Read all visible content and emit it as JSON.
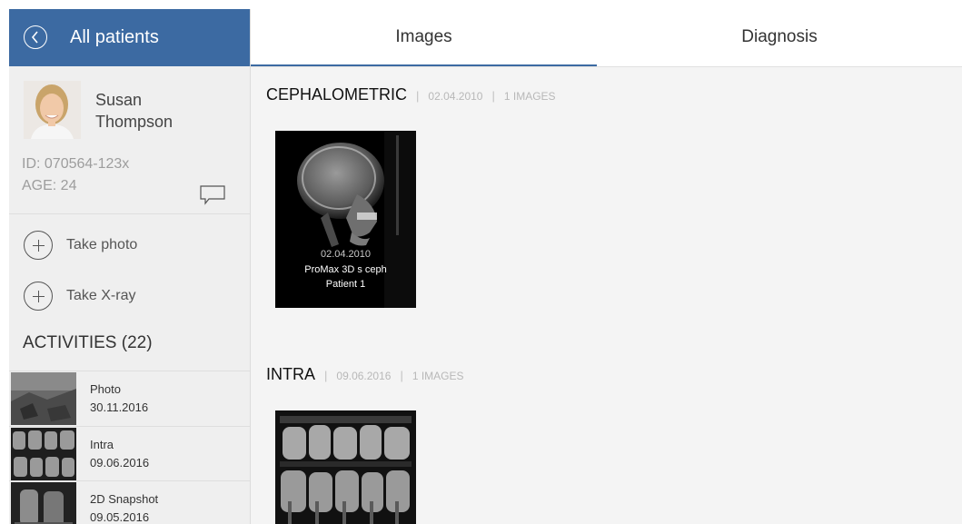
{
  "header": {
    "back_label": "All patients"
  },
  "patient": {
    "first_name": "Susan",
    "last_name": "Thompson",
    "id_text": "ID: 070564-123x",
    "age_text": "AGE: 24"
  },
  "actions": [
    {
      "label": "Take photo"
    },
    {
      "label": "Take X-ray"
    }
  ],
  "activities": {
    "title": "ACTIVITIES (22)",
    "items": [
      {
        "type": "Photo",
        "date": "30.11.2016"
      },
      {
        "type": "Intra",
        "date": "09.06.2016"
      },
      {
        "type": "2D Snapshot",
        "date": "09.05.2016"
      }
    ],
    "more": "..."
  },
  "tabs": [
    {
      "label": "Images",
      "active": true
    },
    {
      "label": "Diagnosis",
      "active": false
    }
  ],
  "sections": [
    {
      "title": "CEPHALOMETRIC",
      "date": "02.04.2010",
      "count": "1 IMAGES",
      "images": [
        {
          "date": "02.04.2010",
          "device": "ProMax 3D s ceph",
          "patient": "Patient 1"
        }
      ]
    },
    {
      "title": "INTRA",
      "date": "09.06.2016",
      "count": "1 IMAGES",
      "images": [
        {}
      ]
    }
  ],
  "colors": {
    "accent": "#3c6aa2",
    "sidebar_bg": "#efefef",
    "main_bg": "#f4f4f4"
  }
}
